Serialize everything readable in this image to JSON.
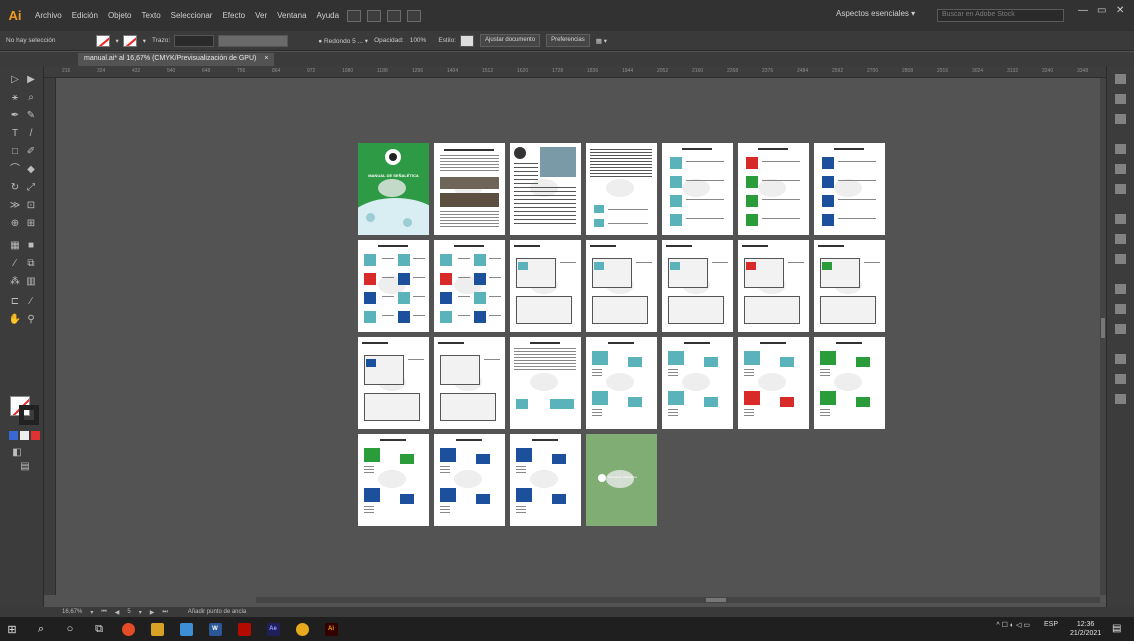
{
  "menubar": {
    "logo": "Ai",
    "items": [
      "Archivo",
      "Edición",
      "Objeto",
      "Texto",
      "Seleccionar",
      "Efecto",
      "Ver",
      "Ventana",
      "Ayuda"
    ],
    "workspace": "Aspectos esenciales",
    "search_placeholder": "Buscar en Adobe Stock"
  },
  "controlbar": {
    "selection": "No hay selección",
    "stroke_label": "Trazo:",
    "brush": "Redondo 5 ...",
    "opacity_label": "Opacidad:",
    "opacity": "100%",
    "style_label": "Estilo:",
    "doc_setup": "Ajustar documento",
    "prefs": "Preferencias"
  },
  "tab": {
    "title": "manual.ai* al 16,67% (CMYK/Previsualización de GPU)",
    "close": "×"
  },
  "ruler": {
    "ticks": [
      "216",
      "324",
      "432",
      "540",
      "648",
      "756",
      "864",
      "972",
      "1080",
      "1188",
      "1296",
      "1404",
      "1512",
      "1620",
      "1728",
      "1836",
      "1944",
      "2052",
      "2160",
      "2268",
      "2376",
      "2484",
      "2592",
      "2700",
      "2808",
      "2916",
      "3024",
      "3132",
      "3240",
      "3348"
    ]
  },
  "statusbar": {
    "zoom": "16,67%",
    "artboard": "5",
    "hint": "Añadir punto de ancla"
  },
  "taskbar": {
    "apps": [
      "Ai",
      "W",
      "Ai",
      "Ae",
      "Ai"
    ],
    "tray": "ESP",
    "time": "12:36",
    "date": "21/2/2021"
  },
  "artboards": {
    "count": 26,
    "rows": [
      7,
      7,
      7,
      4
    ],
    "cover_title": "MANUAL DE SEÑALÉTICA",
    "back_cover_text": "Manual de Señalética"
  },
  "colors": {
    "cover_green": "#2f9a45",
    "teal": "#5ab3ba",
    "red": "#d92a2a",
    "green": "#2a9c3a",
    "blue": "#1c4f9c",
    "back_green": "#7fad73"
  }
}
